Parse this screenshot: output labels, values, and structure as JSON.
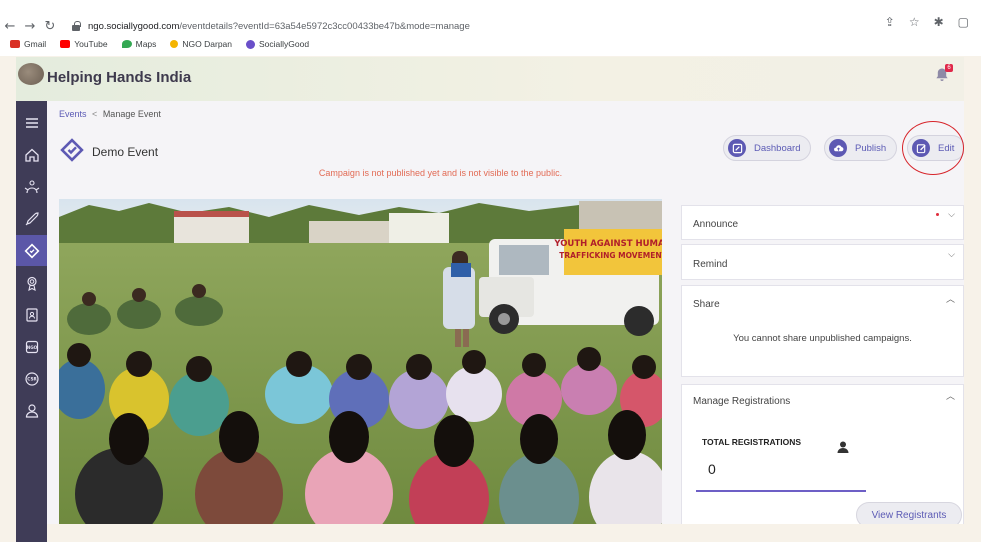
{
  "browser": {
    "url_host": "ngo.sociallygood.com",
    "url_path": "/eventdetails?eventId=63a54e5972c3cc00433be47b&mode=manage",
    "bookmarks": [
      {
        "label": "Gmail",
        "color": "#d93025"
      },
      {
        "label": "YouTube",
        "color": "#ff0000"
      },
      {
        "label": "Maps",
        "color": "#34a853"
      },
      {
        "label": "NGO Darpan",
        "color": "#f4b400"
      },
      {
        "label": "SociallyGood",
        "color": "#6a4fc9"
      }
    ]
  },
  "app": {
    "title": "Helping Hands India",
    "notification_count": "6"
  },
  "breadcrumb": {
    "parent": "Events",
    "separator": "<",
    "current": "Manage Event"
  },
  "event": {
    "title": "Demo Event",
    "warning": "Campaign is not published yet and is not visible to the public."
  },
  "actions": {
    "dashboard": "Dashboard",
    "publish": "Publish",
    "edit": "Edit"
  },
  "photo": {
    "banner_line1": "YOUTH AGAINST HUMAN",
    "banner_line2": "TRAFFICKING MOVEMENT"
  },
  "panels": {
    "announce": "Announce",
    "remind": "Remind",
    "share": "Share",
    "share_message": "You cannot share unpublished campaigns.",
    "registrations": "Manage Registrations",
    "total_label": "TOTAL REGISTRATIONS",
    "total_value": "0",
    "view_button": "View Registrants"
  },
  "colors": {
    "accent": "#5d59b3",
    "sidebar": "#3f3c57",
    "warning": "#e26b55",
    "highlight_ring": "#d7252b"
  }
}
